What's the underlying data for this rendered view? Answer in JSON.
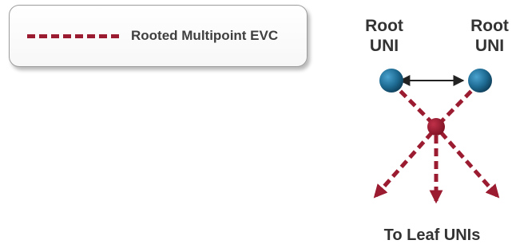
{
  "legend": {
    "label": "Rooted Multipoint EVC",
    "line_color": "#9b1b30"
  },
  "diagram": {
    "root_label_left_line1": "Root",
    "root_label_left_line2": "UNI",
    "root_label_right_line1": "Root",
    "root_label_right_line2": "UNI",
    "leaf_label": "To Leaf UNIs",
    "colors": {
      "root_node": "#1e6b93",
      "hub_node": "#9b1b30",
      "evc_line": "#9b1b30",
      "root_link": "#222222",
      "text": "#333333"
    }
  }
}
